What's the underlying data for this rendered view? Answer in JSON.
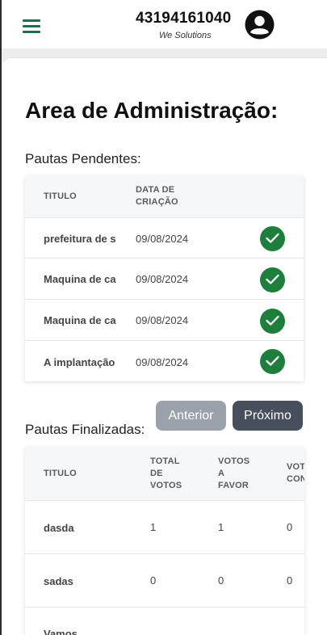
{
  "header": {
    "user_id": "43194161040",
    "company": "We Solutions",
    "menu_icon": "hamburger-icon",
    "avatar_icon": "account-circle-icon",
    "accent_color": "#1f6e4b"
  },
  "main": {
    "title": "Area de Administração:",
    "pending": {
      "label": "Pautas Pendentes:",
      "columns": [
        "TITULO",
        "DATA DE CRIAÇÃO"
      ],
      "rows": [
        {
          "title": "prefeitura de s",
          "date": "09/08/2024"
        },
        {
          "title": "Maquina de ca",
          "date": "09/08/2024"
        },
        {
          "title": "Maquina de ca",
          "date": "09/08/2024"
        },
        {
          "title": "A implantação",
          "date": "09/08/2024"
        }
      ],
      "action_icon": "check-circle-icon",
      "action_color": "#1e7e3c"
    },
    "pagination": {
      "prev_label": "Anterior",
      "next_label": "Próximo"
    },
    "finished": {
      "label": "Pautas Finalizadas:",
      "columns": [
        "TITULO",
        "TOTAL DE VOTOS",
        "VOTOS A FAVOR",
        "VOTOS CONTRA"
      ],
      "rows": [
        {
          "title": "dasda",
          "total": "1",
          "favor": "1",
          "contra": "0"
        },
        {
          "title": "sadas",
          "total": "0",
          "favor": "0",
          "contra": "0"
        },
        {
          "title": "Vamos",
          "total": "",
          "favor": "",
          "contra": ""
        }
      ]
    }
  }
}
